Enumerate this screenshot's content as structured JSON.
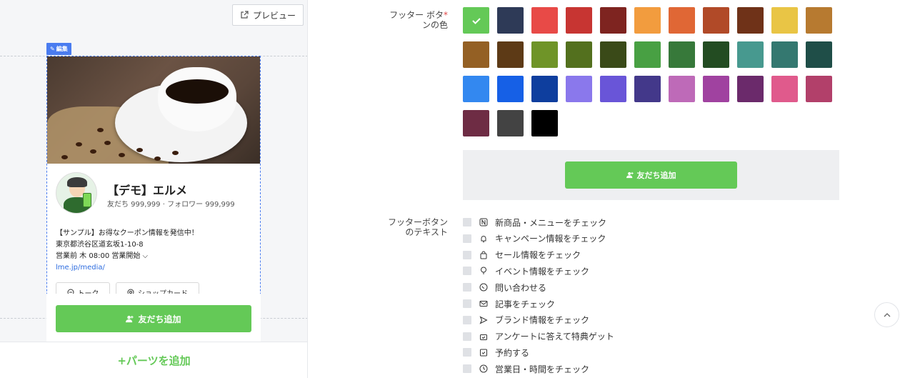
{
  "preview": {
    "preview_button": "プレビュー",
    "edit_tag": "編集",
    "profile_name": "【デモ】エルメ",
    "profile_stats": "友だち 999,999 · フォロワー 999,999",
    "desc_line1": "【サンプル】お得なクーポン情報を発信中！",
    "desc_line2": "東京都渋谷区道玄坂1-10-8",
    "desc_line3": "営業前 木 08:00 営業開始",
    "desc_link": "lme.jp/media/",
    "talk_button": "トーク",
    "shopcard_button": "ショップカード",
    "footer_button": "友だち追加",
    "add_parts": "+パーツを追加"
  },
  "settings": {
    "footer_color_label_line1": "フッター ボタ",
    "footer_color_label_line2": "ンの色",
    "required_mark": "*",
    "selected_color": "#64c957",
    "colors": [
      "#64c957",
      "#2e3a57",
      "#e84a47",
      "#c73532",
      "#7e2420",
      "#f29c3e",
      "#e06735",
      "#b14a28",
      "#6f3218",
      "#e9c545",
      "#b77a30",
      "#946024",
      "#5d3a16",
      "#6f9428",
      "#53701e",
      "#3a4a18",
      "#48a043",
      "#37793a",
      "#234c22",
      "#47998f",
      "#347870",
      "#1f4e48",
      "#3388f0",
      "#1660e6",
      "#0e3e9e",
      "#8a78ec",
      "#6955d8",
      "#43388a",
      "#be6ab8",
      "#a042a0",
      "#6b2a6b",
      "#e05a8c",
      "#b2406a",
      "#6e2c44",
      "#434343",
      "#000000"
    ],
    "preview_button": "友だち追加",
    "footer_text_label_line1": "フッターボタン",
    "footer_text_label_line2": "のテキスト",
    "options": [
      {
        "icon": "news-icon",
        "label": "新商品・メニューをチェック"
      },
      {
        "icon": "bell-icon",
        "label": "キャンペーン情報をチェック"
      },
      {
        "icon": "bag-icon",
        "label": "セール情報をチェック"
      },
      {
        "icon": "balloon-icon",
        "label": "イベント情報をチェック"
      },
      {
        "icon": "phone-icon",
        "label": "問い合わせる"
      },
      {
        "icon": "mail-icon",
        "label": "記事をチェック"
      },
      {
        "icon": "send-icon",
        "label": "ブランド情報をチェック"
      },
      {
        "icon": "gift-icon",
        "label": "アンケートに答えて特典ゲット"
      },
      {
        "icon": "calendar-check-icon",
        "label": "予約する"
      },
      {
        "icon": "clock-icon",
        "label": "営業日・時間をチェック"
      }
    ]
  }
}
